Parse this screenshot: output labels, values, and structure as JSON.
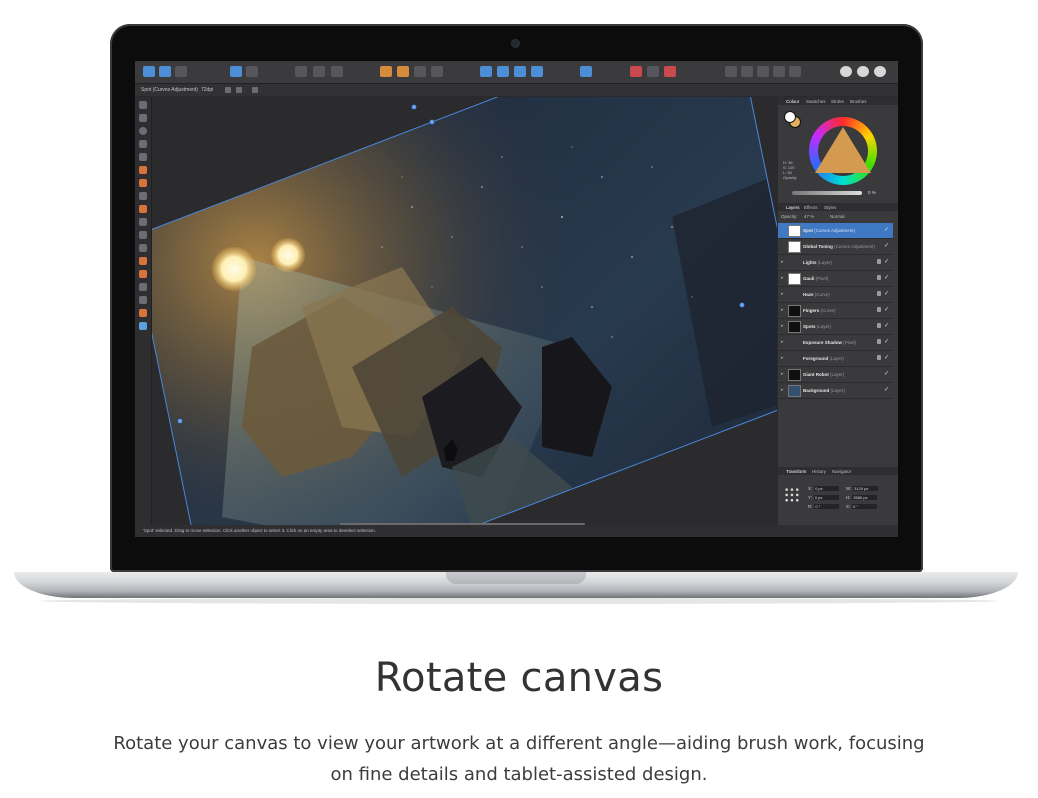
{
  "app": {
    "context_bar": {
      "selection": "Spot (Curves Adjustment)",
      "dpi": "72dpi"
    },
    "status_bar": "'Spot' selected. Drag to move selection. Click another object to select it. Click on an empty area to deselect selection.",
    "panels": {
      "colour_tabs": [
        "Colour",
        "Swatches",
        "Stroke",
        "Brushes"
      ],
      "hsl": [
        "H: 36",
        "S: 100",
        "L: 60"
      ],
      "opacity_label": "Opacity",
      "opacity_value": "0 %",
      "layer_tabs": [
        "Layers",
        "Effects",
        "Styles"
      ],
      "layer_opacity_label": "Opacity:",
      "layer_opacity_value": "47 %",
      "blend_mode": "Normal",
      "layers": [
        {
          "name": "Spot",
          "type": "(Curves Adjustment)"
        },
        {
          "name": "Global Toning",
          "type": "(Curves Adjustment)"
        },
        {
          "name": "Lights",
          "type": "(Layer)"
        },
        {
          "name": "Gauli",
          "type": "(Pixel)"
        },
        {
          "name": "Haze",
          "type": "(Curve)"
        },
        {
          "name": "Fingers",
          "type": "(Curve)"
        },
        {
          "name": "Spots",
          "type": "(Layer)"
        },
        {
          "name": "Exposure Shadow",
          "type": "(Pixel)"
        },
        {
          "name": "Foreground",
          "type": "(Layer)"
        },
        {
          "name": "Giant Robot",
          "type": "(Layer)"
        },
        {
          "name": "Background",
          "type": "(Layer)"
        }
      ],
      "transform_tabs": [
        "Transform",
        "History",
        "Navigator"
      ],
      "transform": {
        "x": "X:",
        "x_val": "0 px",
        "y": "Y:",
        "y_val": "0 px",
        "w": "W:",
        "w_val": "3120 px",
        "h": "H:",
        "h_val": "2680 px",
        "r": "R:",
        "r_val": "0 °",
        "s": "S:",
        "s_val": "0 °"
      }
    }
  },
  "caption": {
    "title": "Rotate canvas",
    "description": "Rotate your canvas to view your artwork at a different angle—aiding brush work, focusing on fine details and tablet-assisted design."
  },
  "colors": {
    "selection_blue": "#3f78c3",
    "accent_orange": "#d9733a"
  }
}
